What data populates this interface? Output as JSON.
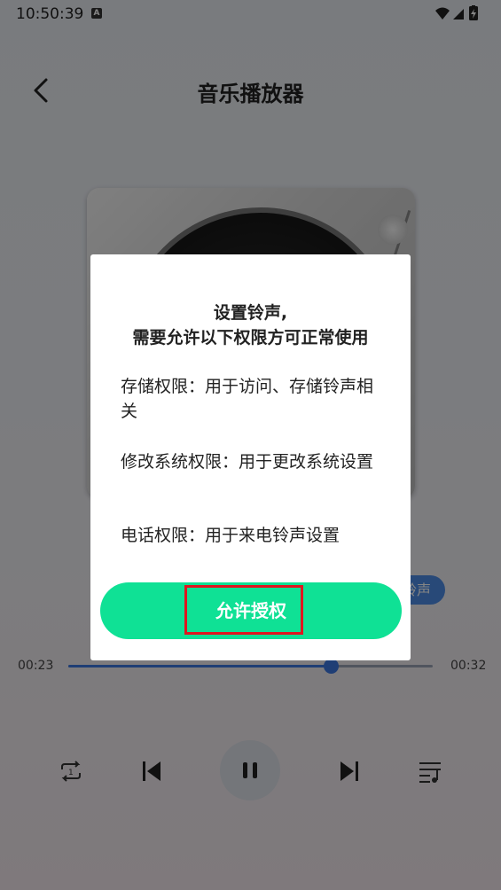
{
  "status_bar": {
    "time": "10:50:39",
    "notification_badge": "A",
    "icons": [
      "wifi-icon",
      "signal-icon",
      "battery-charging-icon"
    ]
  },
  "header": {
    "back_icon": "chevron-left-icon",
    "title": "音乐播放器"
  },
  "player": {
    "ringtone_chip": "铃声",
    "current_time": "00:23",
    "total_time": "00:32",
    "progress": 0.72,
    "accent_color": "#3d78e0",
    "controls": [
      "repeat-icon",
      "previous-icon",
      "pause-icon",
      "next-icon",
      "playlist-icon"
    ]
  },
  "dialog": {
    "title_line1": "设置铃声,",
    "title_line2": "需要允许以下权限方可正常使用",
    "permissions": [
      "存储权限：用于访问、存储铃声相关",
      "修改系统权限：用于更改系统设置",
      "电话权限：用于来电铃声设置"
    ],
    "allow_button": "允许授权",
    "button_color": "#0fe195",
    "highlight_color": "#e0161f"
  }
}
